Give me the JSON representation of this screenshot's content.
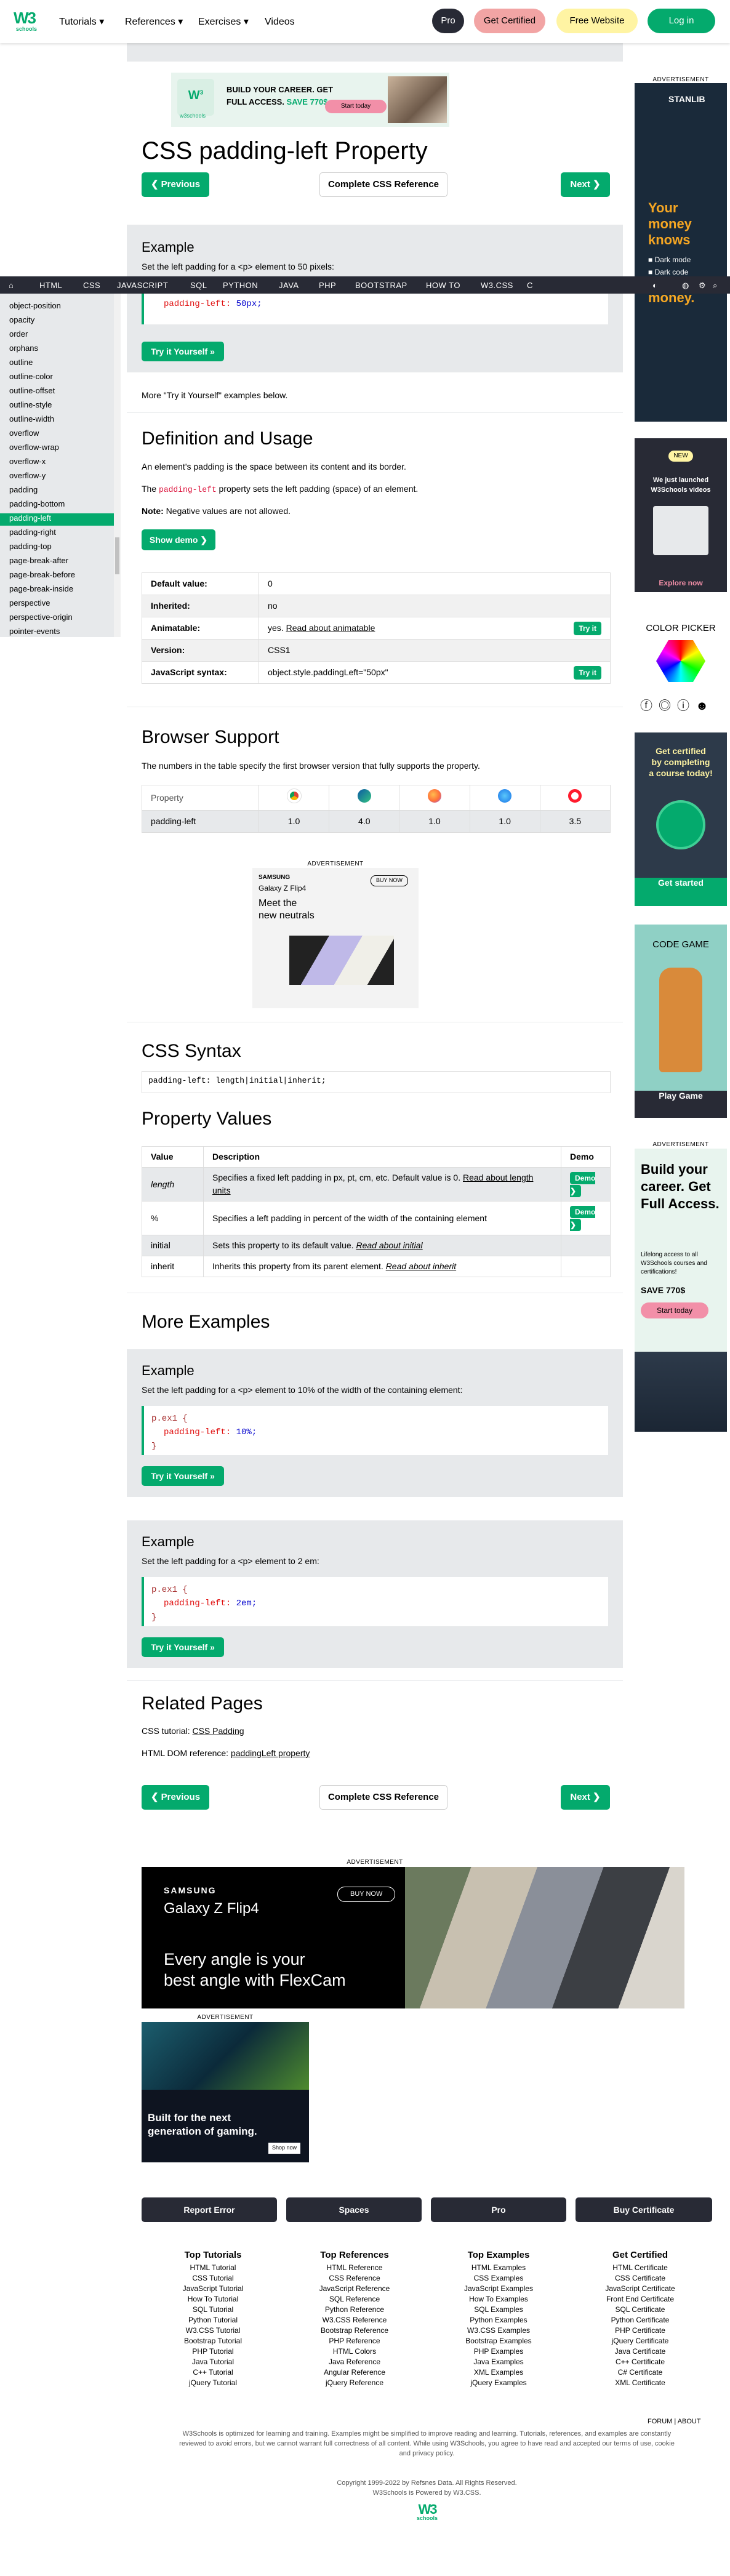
{
  "topbar": {
    "logo_main": "W3",
    "logo_sub": "schools",
    "nav": [
      "Tutorials",
      "References",
      "Exercises",
      "Videos"
    ],
    "pro": "Pro",
    "get_certified": "Get Certified",
    "free_website": "Free Website",
    "login": "Log in"
  },
  "darknav": {
    "items": [
      "HTML",
      "CSS",
      "JAVASCRIPT",
      "SQL",
      "PYTHON",
      "JAVA",
      "PHP",
      "BOOTSTRAP",
      "HOW TO",
      "W3.CSS",
      "C"
    ]
  },
  "sidebar": {
    "items": [
      "object-position",
      "opacity",
      "order",
      "orphans",
      "outline",
      "outline-color",
      "outline-offset",
      "outline-style",
      "outline-width",
      "overflow",
      "overflow-wrap",
      "overflow-x",
      "overflow-y",
      "padding",
      "padding-bottom",
      "padding-left",
      "padding-right",
      "padding-top",
      "page-break-after",
      "page-break-before",
      "page-break-inside",
      "perspective",
      "perspective-origin",
      "pointer-events"
    ],
    "selected": 15
  },
  "top_ad": {
    "logo": "w3schools",
    "line1": "BUILD YOUR CAREER. GET",
    "line2": "FULL ACCESS.",
    "save": "SAVE 770$",
    "cta": "Start today"
  },
  "page": {
    "title": "CSS padding-left Property",
    "prev": "❮ Previous",
    "complete": "Complete CSS Reference",
    "next": "Next ❯",
    "example_heading": "Example",
    "example_desc": "Set the left padding for a <p> element to 50 pixels:",
    "example_code_prop": "padding-left:",
    "example_code_val": "50px;",
    "try_it": "Try it Yourself »",
    "more_text": "More \"Try it Yourself\" examples below.",
    "def_heading": "Definition and Usage",
    "def_p1": "An element's padding is the space between its content and its border.",
    "def_p2a": "The ",
    "def_p2kw": "padding-left",
    "def_p2b": " property sets the left padding (space) of an element.",
    "def_note_b": "Note:",
    "def_note": " Negative values are not allowed.",
    "show_demo": "Show demo ❯",
    "props": [
      {
        "k": "Default value:",
        "v": "0",
        "link": "",
        "btn": ""
      },
      {
        "k": "Inherited:",
        "v": "no",
        "link": "",
        "btn": ""
      },
      {
        "k": "Animatable:",
        "v": "yes. ",
        "link": "Read about animatable",
        "btn": "Try it"
      },
      {
        "k": "Version:",
        "v": "CSS1",
        "link": "",
        "btn": ""
      },
      {
        "k": "JavaScript syntax:",
        "v": "object.style.paddingLeft=\"50px\"",
        "link": "",
        "btn": "Try it"
      }
    ],
    "browser_heading": "Browser Support",
    "browser_desc": "The numbers in the table specify the first browser version that fully supports the property.",
    "browser_row_head": "Property",
    "browser_prop": "padding-left",
    "browser_versions": [
      "1.0",
      "4.0",
      "1.0",
      "1.0",
      "3.5"
    ],
    "ad_mid_label": "ADVERTISEMENT",
    "ad_mid": {
      "brand": "SAMSUNG",
      "model": "Galaxy Z Flip4",
      "cta": "BUY NOW",
      "line1": "Meet the",
      "line2": "new neutrals"
    },
    "syntax_heading": "CSS Syntax",
    "syntax_code": "padding-left: length|initial|inherit;",
    "pv_heading": "Property Values",
    "pv_cols": [
      "Value",
      "Description",
      "Demo"
    ],
    "pv_rows": [
      {
        "v": "length",
        "d": "Specifies a fixed left padding in px, pt, cm, etc. Default value is 0. ",
        "link": "Read about length units",
        "demo": "Demo ❯"
      },
      {
        "v": "%",
        "d": "Specifies a left padding in percent of the width of the containing element",
        "link": "",
        "demo": "Demo ❯"
      },
      {
        "v": "initial",
        "d": "Sets this property to its default value. ",
        "link": "Read about initial",
        "demo": ""
      },
      {
        "v": "inherit",
        "d": "Inherits this property from its parent element. ",
        "link": "Read about inherit",
        "demo": ""
      }
    ],
    "more_heading": "More Examples",
    "ex2_desc": "Set the left padding for a <p> element to 10% of the width of the containing element:",
    "ex2_sel": "p.ex1 {",
    "ex2_val": "10%;",
    "ex3_desc": "Set the left padding for a <p> element to 2 em:",
    "ex3_sel": "p.ex1 {",
    "ex3_val": "2em;",
    "close_brace": "}",
    "related_heading": "Related Pages",
    "rel1_label": "CSS tutorial: ",
    "rel1_link": "CSS Padding",
    "rel2_label": "HTML DOM reference: ",
    "rel2_link": "paddingLeft property"
  },
  "bottom_ads": {
    "label": "ADVERTISEMENT",
    "big": {
      "brand": "SAMSUNG",
      "model": "Galaxy Z Flip4",
      "cta": "BUY NOW",
      "line1": "Every angle is your",
      "line2": "best angle with FlexCam"
    },
    "small": {
      "line1": "Built for the next",
      "line2": "generation of gaming.",
      "cta": "Shop now"
    }
  },
  "right": {
    "ad_label": "ADVERTISEMENT",
    "stanlib": "STANLIB",
    "money1": "Your",
    "money2": "money",
    "money3": "knows",
    "dark_mode": "Dark mode",
    "dark_code": "Dark code",
    "money4": "money.",
    "new_badge": "NEW",
    "launched1": "We just launched",
    "launched2": "W3Schools videos",
    "explore": "Explore now",
    "color_picker": "COLOR PICKER",
    "cert1": "Get certified",
    "cert2": "by completing",
    "cert3": "a course today!",
    "cert_btn": "Get started",
    "code_game": "CODE GAME",
    "play_game": "Play Game",
    "ad2_label": "ADVERTISEMENT",
    "build1": "Build your",
    "build2": "career. Get",
    "build3": "Full Access.",
    "lifelong": "Lifelong access to all W3Schools courses and certifications!",
    "save": "SAVE 770$",
    "start": "Start today"
  },
  "footer": {
    "buttons": [
      "Report Error",
      "Spaces",
      "Pro",
      "Buy Certificate"
    ],
    "cols": [
      {
        "h": "Top Tutorials",
        "items": [
          "HTML Tutorial",
          "CSS Tutorial",
          "JavaScript Tutorial",
          "How To Tutorial",
          "SQL Tutorial",
          "Python Tutorial",
          "W3.CSS Tutorial",
          "Bootstrap Tutorial",
          "PHP Tutorial",
          "Java Tutorial",
          "C++ Tutorial",
          "jQuery Tutorial"
        ]
      },
      {
        "h": "Top References",
        "items": [
          "HTML Reference",
          "CSS Reference",
          "JavaScript Reference",
          "SQL Reference",
          "Python Reference",
          "W3.CSS Reference",
          "Bootstrap Reference",
          "PHP Reference",
          "HTML Colors",
          "Java Reference",
          "Angular Reference",
          "jQuery Reference"
        ]
      },
      {
        "h": "Top Examples",
        "items": [
          "HTML Examples",
          "CSS Examples",
          "JavaScript Examples",
          "How To Examples",
          "SQL Examples",
          "Python Examples",
          "W3.CSS Examples",
          "Bootstrap Examples",
          "PHP Examples",
          "Java Examples",
          "XML Examples",
          "jQuery Examples"
        ]
      },
      {
        "h": "Get Certified",
        "items": [
          "HTML Certificate",
          "CSS Certificate",
          "JavaScript Certificate",
          "Front End Certificate",
          "SQL Certificate",
          "Python Certificate",
          "PHP Certificate",
          "jQuery Certificate",
          "Java Certificate",
          "C++ Certificate",
          "C# Certificate",
          "XML Certificate"
        ]
      }
    ],
    "forum": "FORUM",
    "about": "ABOUT",
    "disclaimer1": "W3Schools is optimized for learning and training. Examples might be simplified to improve reading and learning. Tutorials, references, and examples are constantly",
    "disclaimer2": "reviewed to avoid errors, but we cannot warrant full correctness of all content. While using W3Schools, you agree to have read and accepted our terms of use, cookie",
    "disclaimer3": "and privacy policy.",
    "copyright": "Copyright 1999-2022 by Refsnes Data. All Rights Reserved.",
    "powered": "W3Schools is Powered by W3.CSS.",
    "logo_main": "W3",
    "logo_sub": "schools"
  }
}
